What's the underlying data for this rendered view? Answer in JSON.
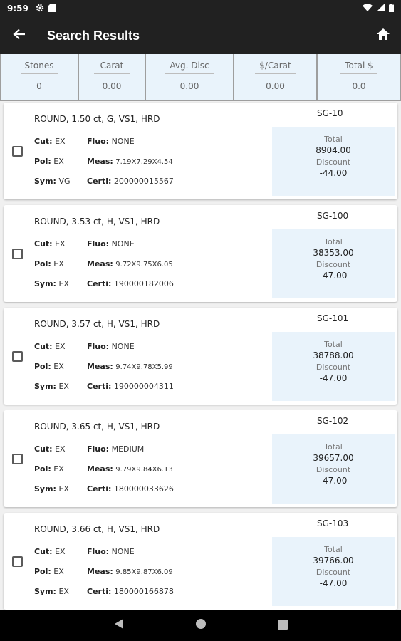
{
  "status": {
    "time": "9:59"
  },
  "app_bar": {
    "title": "Search Results"
  },
  "summary": [
    {
      "label": "Stones",
      "value": "0"
    },
    {
      "label": "Carat",
      "value": "0.00"
    },
    {
      "label": "Avg. Disc",
      "value": "0.00"
    },
    {
      "label": "$/Carat",
      "value": "0.00"
    },
    {
      "label": "Total $",
      "value": "0.0"
    }
  ],
  "labels": {
    "cut": "Cut:",
    "pol": "Pol:",
    "sym": "Sym:",
    "fluo": "Fluo:",
    "meas": "Meas:",
    "certi": "Certi:",
    "total": "Total",
    "discount": "Discount"
  },
  "results": [
    {
      "title": "ROUND, 1.50 ct, G, VS1, HRD",
      "code": "SG-10",
      "cut": "EX",
      "pol": "EX",
      "sym": "VG",
      "fluo": "NONE",
      "meas": "7.19X7.29X4.54",
      "certi": "200000015567",
      "total": "8904.00",
      "discount": "-44.00"
    },
    {
      "title": "ROUND, 3.53 ct, H, VS1, HRD",
      "code": "SG-100",
      "cut": "EX",
      "pol": "EX",
      "sym": "EX",
      "fluo": "NONE",
      "meas": "9.72X9.75X6.05",
      "certi": "190000182006",
      "total": "38353.00",
      "discount": "-47.00"
    },
    {
      "title": "ROUND, 3.57 ct, H, VS1, HRD",
      "code": "SG-101",
      "cut": "EX",
      "pol": "EX",
      "sym": "EX",
      "fluo": "NONE",
      "meas": "9.74X9.78X5.99",
      "certi": "190000004311",
      "total": "38788.00",
      "discount": "-47.00"
    },
    {
      "title": "ROUND, 3.65 ct, H, VS1, HRD",
      "code": "SG-102",
      "cut": "EX",
      "pol": "EX",
      "sym": "EX",
      "fluo": "MEDIUM",
      "meas": "9.79X9.84X6.13",
      "certi": "180000033626",
      "total": "39657.00",
      "discount": "-47.00"
    },
    {
      "title": "ROUND, 3.66 ct, H, VS1, HRD",
      "code": "SG-103",
      "cut": "EX",
      "pol": "EX",
      "sym": "EX",
      "fluo": "NONE",
      "meas": "9.85X9.87X6.09",
      "certi": "180000166878",
      "total": "39766.00",
      "discount": "-47.00"
    }
  ],
  "icons": {
    "back": "arrow-left-icon",
    "home": "home-icon",
    "nav_back": "triangle-back-icon",
    "nav_home": "circle-home-icon",
    "nav_recents": "square-recents-icon"
  }
}
